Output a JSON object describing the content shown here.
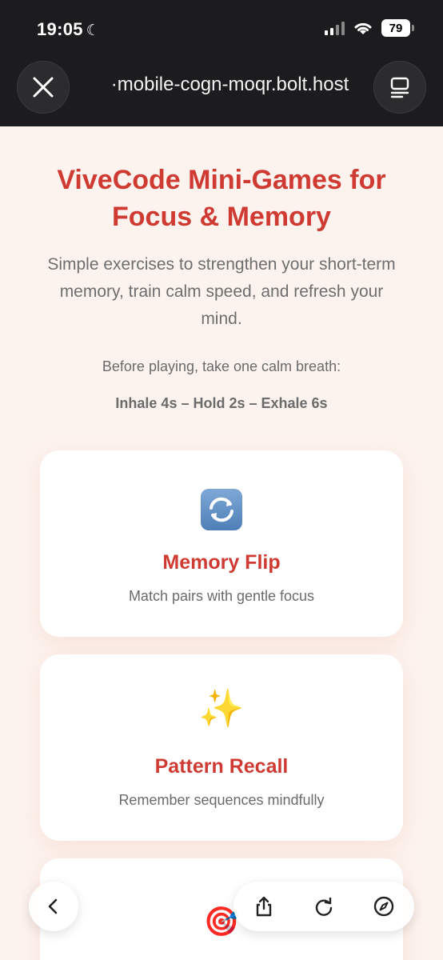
{
  "status": {
    "time": "19:05",
    "battery": "79"
  },
  "browser": {
    "url": "·mobile-cogn-moqr.bolt.host"
  },
  "hero": {
    "title": "ViveCode Mini-Games for Focus & Memory",
    "subtitle": "Simple exercises to strengthen your short-term memory, train calm speed, and refresh your mind.",
    "breath_intro": "Before playing, take one calm breath:",
    "breath_pattern": "Inhale 4s – Hold 2s – Exhale 6s"
  },
  "games": [
    {
      "icon": "repeat-arrows-icon",
      "title": "Memory Flip",
      "desc": "Match pairs with gentle focus"
    },
    {
      "icon": "sparkles-icon",
      "emoji": "✨",
      "title": "Pattern Recall",
      "desc": "Remember sequences mindfully"
    },
    {
      "icon": "target-icon",
      "emoji": "🎯"
    }
  ],
  "colors": {
    "accent": "#cf3b32",
    "background": "#fdf3ee",
    "topbar": "#1c1c1e"
  }
}
